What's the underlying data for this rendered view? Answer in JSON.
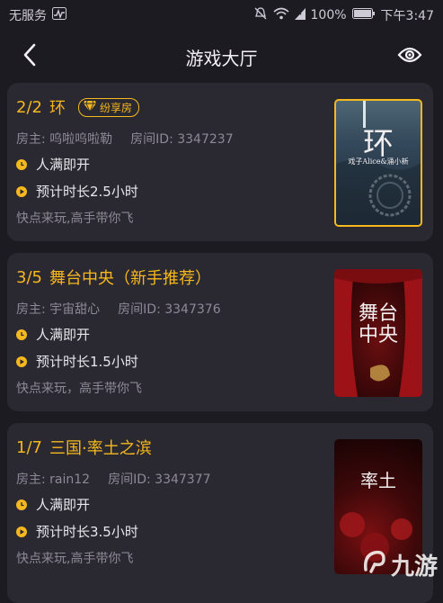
{
  "status": {
    "carrier": "无服务",
    "battery": "100%",
    "time": "下午3:47"
  },
  "header": {
    "title": "游戏大厅"
  },
  "rooms": [
    {
      "count_current": "2",
      "count_sep": "/",
      "count_max": "2",
      "title": "环",
      "badge": "纷享房",
      "host": "房主: 呜啦呜啦勒",
      "room_id": "房间ID: 3347237",
      "start_rule": "人满即开",
      "duration": "预计时长2.5小时",
      "desc": "快点来玩,高手带你飞",
      "cover_title": "环",
      "cover_sub": "戏子Alice&涌小新"
    },
    {
      "count_current": "3",
      "count_sep": "/",
      "count_max": "5",
      "title": "舞台中央（新手推荐）",
      "host": "房主: 宇宙甜心",
      "room_id": "房间ID: 3347376",
      "start_rule": "人满即开",
      "duration": "预计时长1.5小时",
      "desc": "快点来玩，高手带你飞",
      "cover_title": "舞台中央"
    },
    {
      "count_current": "1",
      "count_sep": "/",
      "count_max": "7",
      "title": "三国·率土之滨",
      "host": "房主: rain12",
      "room_id": "房间ID: 3347377",
      "start_rule": "人满即开",
      "duration": "预计时长3.5小时",
      "desc": "快点来玩,高手带你飞",
      "cover_title": "率土"
    }
  ],
  "watermark": {
    "text": "九游"
  },
  "colors": {
    "accent": "#f5b81e",
    "card": "#2a2830",
    "bg": "#1d1b22"
  }
}
